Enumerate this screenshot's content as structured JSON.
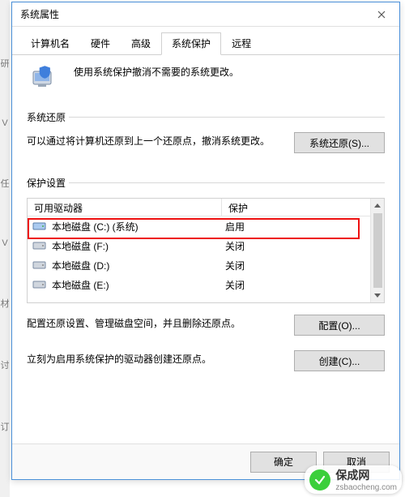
{
  "window": {
    "title": "系统属性",
    "close_label": "关闭"
  },
  "tabs": [
    {
      "label": "计算机名"
    },
    {
      "label": "硬件"
    },
    {
      "label": "高级"
    },
    {
      "label": "系统保护",
      "active": true
    },
    {
      "label": "远程"
    }
  ],
  "intro_text": "使用系统保护撤消不需要的系统更改。",
  "restore_section": {
    "title": "系统还原",
    "desc": "可以通过将计算机还原到上一个还原点，撤消系统更改。",
    "button": "系统还原(S)..."
  },
  "protection_section": {
    "title": "保护设置",
    "columns": {
      "drive": "可用驱动器",
      "protection": "保护"
    },
    "drives": [
      {
        "name": "本地磁盘 (C:) (系统)",
        "protection": "启用",
        "highlighted": true
      },
      {
        "name": "本地磁盘 (F:)",
        "protection": "关闭"
      },
      {
        "name": "本地磁盘 (D:)",
        "protection": "关闭"
      },
      {
        "name": "本地磁盘 (E:)",
        "protection": "关闭"
      }
    ],
    "configure_desc": "配置还原设置、管理磁盘空间，并且删除还原点。",
    "configure_button": "配置(O)...",
    "create_desc": "立刻为启用系统保护的驱动器创建还原点。",
    "create_button": "创建(C)..."
  },
  "footer": {
    "ok": "确定",
    "cancel": "取消"
  },
  "watermark": {
    "brand": "保成网",
    "domain": "zsbaocheng.com"
  }
}
